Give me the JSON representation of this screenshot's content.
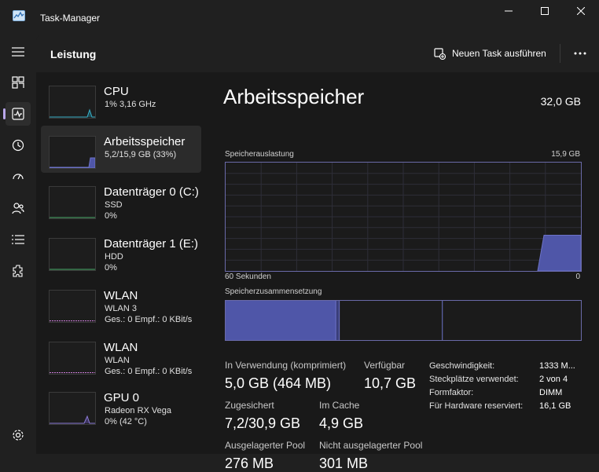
{
  "window": {
    "title": "Task-Manager"
  },
  "colors": {
    "accent": "#b9a7ea",
    "memory": "#6d73c8",
    "memory_fill": "#4f56a8",
    "network": "#c97bd6",
    "cpu": "#38b0c8"
  },
  "header": {
    "title": "Leistung",
    "new_task_label": "Neuen Task ausführen"
  },
  "sidebar": {
    "items": [
      {
        "icon": "hamburger-menu-icon"
      },
      {
        "icon": "processes-icon"
      },
      {
        "icon": "performance-icon",
        "active": true
      },
      {
        "icon": "app-history-icon"
      },
      {
        "icon": "startup-apps-icon"
      },
      {
        "icon": "users-icon"
      },
      {
        "icon": "details-icon"
      },
      {
        "icon": "services-icon"
      },
      {
        "icon": "settings-icon"
      }
    ]
  },
  "devices": [
    {
      "name": "CPU",
      "line1": "1% 3,16 GHz",
      "line2": "",
      "usage": 0.01
    },
    {
      "name": "Arbeitsspeicher",
      "line1": "5,2/15,9 GB (33%)",
      "line2": "",
      "usage": 0.33,
      "active": true
    },
    {
      "name": "Datenträger 0 (C:)",
      "line1": "SSD",
      "line2": "0%",
      "usage": 0
    },
    {
      "name": "Datenträger 1 (E:)",
      "line1": "HDD",
      "line2": "0%",
      "usage": 0
    },
    {
      "name": "WLAN",
      "line1": "WLAN 3",
      "line2": "Ges.: 0 Empf.: 0 KBit/s",
      "usage": 0
    },
    {
      "name": "WLAN",
      "line1": "WLAN",
      "line2": "Ges.: 0 Empf.: 0 KBit/s",
      "usage": 0
    },
    {
      "name": "GPU 0",
      "line1": "Radeon RX Vega",
      "line2": "0% (42 °C)",
      "usage": 0
    }
  ],
  "detail": {
    "title": "Arbeitsspeicher",
    "total": "32,0 GB",
    "usage_label": "Speicherauslastung",
    "usage_max": "15,9 GB",
    "time_left": "60 Sekunden",
    "time_right": "0",
    "composition_label": "Speicherzusammensetzung",
    "stats": {
      "in_use_label": "In Verwendung (komprimiert)",
      "in_use_value": "5,0 GB (464 MB)",
      "available_label": "Verfügbar",
      "available_value": "10,7 GB",
      "committed_label": "Zugesichert",
      "committed_value": "7,2/30,9 GB",
      "cached_label": "Im Cache",
      "cached_value": "4,9 GB",
      "paged_label": "Ausgelagerter Pool",
      "paged_value": "276 MB",
      "nonpaged_label": "Nicht ausgelagerter Pool",
      "nonpaged_value": "301 MB"
    },
    "props": [
      {
        "label": "Geschwindigkeit:",
        "value": "1333 M..."
      },
      {
        "label": "Steckplätze verwendet:",
        "value": "2 von 4"
      },
      {
        "label": "Formfaktor:",
        "value": "DIMM"
      },
      {
        "label": "Für Hardware reserviert:",
        "value": "16,1 GB"
      }
    ],
    "usage_fraction": 0.33,
    "composition_fractions": {
      "in_use": 0.31,
      "modified": 0.01,
      "standby": 0.29,
      "free": 0.38
    }
  }
}
